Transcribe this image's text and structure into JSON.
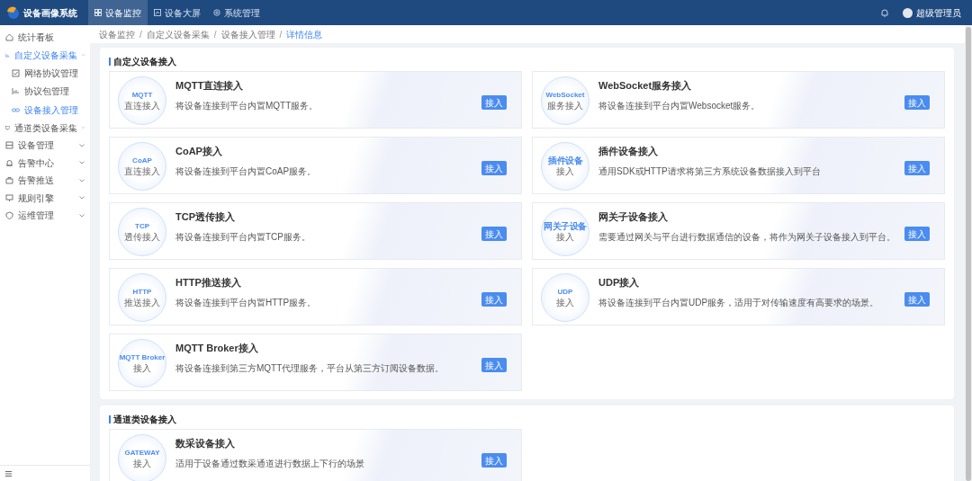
{
  "header": {
    "app_name": "设备画像系统",
    "nav": [
      {
        "label": "设备监控",
        "selected": true
      },
      {
        "label": "设备大屏",
        "selected": false
      },
      {
        "label": "系统管理",
        "selected": false
      }
    ],
    "user_name": "超级管理员"
  },
  "sidebar": {
    "items": [
      {
        "label": "统计看板",
        "selected": false
      },
      {
        "label": "自定义设备采集",
        "selected": false,
        "expanded": true,
        "children": [
          {
            "label": "网络协议管理",
            "selected": false
          },
          {
            "label": "协议包管理",
            "selected": false
          },
          {
            "label": "设备接入管理",
            "selected": true
          }
        ]
      },
      {
        "label": "通道类设备采集",
        "selected": false,
        "expanded": false
      },
      {
        "label": "设备管理",
        "selected": false,
        "expanded": false
      },
      {
        "label": "告警中心",
        "selected": false,
        "expanded": false
      },
      {
        "label": "告警推送",
        "selected": false,
        "expanded": false
      },
      {
        "label": "规则引擎",
        "selected": false,
        "expanded": false
      },
      {
        "label": "运维管理",
        "selected": false,
        "expanded": false
      }
    ]
  },
  "breadcrumb": {
    "separator": "/",
    "items": [
      "设备监控",
      "自定义设备采集",
      "设备接入管理",
      "详情信息"
    ]
  },
  "sections": [
    {
      "title": "自定义设备接入",
      "cards": [
        {
          "badge_title": "MQTT",
          "badge_subtitle": "直连接入",
          "title": "MQTT直连接入",
          "description": "将设备连接到平台内置MQTT服务。",
          "button": "接入"
        },
        {
          "badge_title": "WebSocket",
          "badge_subtitle": "服务接入",
          "title": "WebSocket服务接入",
          "description": "将设备连接到平台内置Websocket服务。",
          "button": "接入"
        },
        {
          "badge_title": "CoAP",
          "badge_subtitle": "直连接入",
          "title": "CoAP接入",
          "description": "将设备连接到平台内置CoAP服务。",
          "button": "接入"
        },
        {
          "badge_title": "插件设备",
          "badge_subtitle": "接入",
          "title": "插件设备接入",
          "description": "通用SDK或HTTP请求将第三方系统设备数据接入到平台",
          "button": "接入"
        },
        {
          "badge_title": "TCP",
          "badge_subtitle": "透传接入",
          "title": "TCP透传接入",
          "description": "将设备连接到平台内置TCP服务。",
          "button": "接入"
        },
        {
          "badge_title": "网关子设备",
          "badge_subtitle": "接入",
          "title": "网关子设备接入",
          "description": "需要通过网关与平台进行数据通信的设备，将作为网关子设备接入到平台。",
          "button": "接入"
        },
        {
          "badge_title": "HTTP",
          "badge_subtitle": "推送接入",
          "title": "HTTP推送接入",
          "description": "将设备连接到平台内置HTTP服务。",
          "button": "接入"
        },
        {
          "badge_title": "UDP",
          "badge_subtitle": "接入",
          "title": "UDP接入",
          "description": "将设备连接到平台内置UDP服务，适用于对传输速度有高要求的场景。",
          "button": "接入"
        },
        {
          "badge_title": "MQTT Broker",
          "badge_subtitle": "接入",
          "title": "MQTT Broker接入",
          "description": "将设备连接到第三方MQTT代理服务，平台从第三方订阅设备数据。",
          "button": "接入"
        }
      ]
    },
    {
      "title": "通道类设备接入",
      "cards": [
        {
          "badge_title": "GATEWAY",
          "badge_subtitle": "接入",
          "title": "数采设备接入",
          "description": "适用于设备通过数采通道进行数据上下行的场景",
          "button": "接入"
        }
      ]
    }
  ]
}
